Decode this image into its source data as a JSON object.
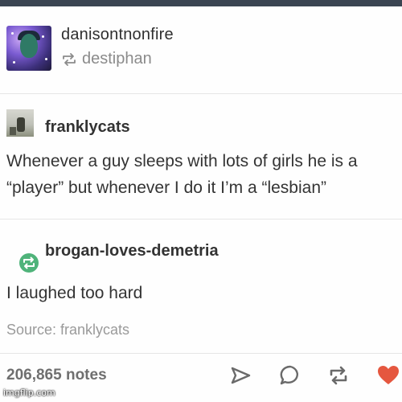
{
  "post": {
    "reblogger": {
      "username": "danisontnonfire",
      "via_username": "destiphan"
    },
    "original": {
      "username": "franklycats",
      "text": "Whenever a guy sleeps with lots of girls he is a “player” but whenever I do it I’m a “lesbian”"
    },
    "reblog": {
      "username": "brogan-loves-demetria",
      "comment": "I laughed too hard"
    },
    "source_label": "Source: franklycats",
    "notes": "206,865 notes"
  },
  "icons": {
    "via": "reblog-icon",
    "share": "share-icon",
    "reply": "reply-icon",
    "reblog": "reblog-icon",
    "like": "heart-icon"
  },
  "colors": {
    "like": "#e5573f",
    "reblog_badge": "#4fb37a"
  },
  "watermark": "imgflip.com"
}
